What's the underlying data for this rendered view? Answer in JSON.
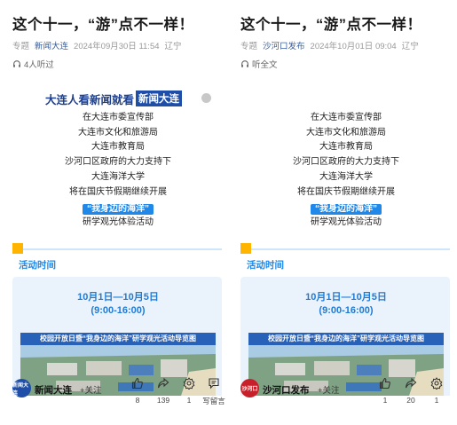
{
  "articles": [
    {
      "title": "这个十一，“游”点不一样！",
      "meta": {
        "tag": "专题",
        "source": "新闻大连",
        "datetime": "2024年09月30日 11:54",
        "region": "辽宁"
      },
      "listen_text": "4人听过",
      "banner": {
        "text": "大连人看新闻就看",
        "highlight": "新闻大连"
      },
      "lines": [
        "在大连市委宣传部",
        "大连市文化和旅游局",
        "大连市教育局",
        "沙河口区政府的大力支持下",
        "大连海洋大学",
        "将在国庆节假期继续开展",
        "“我身边的海洋”",
        "研学观光体验活动"
      ],
      "section_title": "活动时间",
      "dates": "10月1日—10月5日",
      "hours": "(9:00-16:00)",
      "map_title": "校园开放日暨“我身边的海洋”研学观光活动导览图",
      "account": {
        "name": "新闻大连",
        "logo_text": "新闻大连",
        "logo_color": "#1e4ea8",
        "follow": "+关注"
      },
      "actions": [
        {
          "icon": "thumbs-up-icon",
          "count": "8"
        },
        {
          "icon": "share-icon",
          "count": "139"
        },
        {
          "icon": "gear-icon",
          "count": "1"
        },
        {
          "icon": "comment-icon",
          "count": "写留言"
        }
      ]
    },
    {
      "title": "这个十一，“游”点不一样！",
      "meta": {
        "tag": "专题",
        "source": "沙河口发布",
        "datetime": "2024年10月01日 09:04",
        "region": "辽宁"
      },
      "listen_text": "听全文",
      "banner": {
        "text": "",
        "highlight": ""
      },
      "lines": [
        "在大连市委宣传部",
        "大连市文化和旅游局",
        "大连市教育局",
        "沙河口区政府的大力支持下",
        "大连海洋大学",
        "将在国庆节假期继续开展",
        "“我身边的海洋”",
        "研学观光体验活动"
      ],
      "section_title": "活动时间",
      "dates": "10月1日—10月5日",
      "hours": "(9:00-16:00)",
      "map_title": "校园开放日暨“我身边的海洋”研学观光活动导览图",
      "account": {
        "name": "沙河口发布",
        "logo_text": "沙河口",
        "logo_color": "#c8202a",
        "follow": "+关注"
      },
      "actions": [
        {
          "icon": "thumbs-up-icon",
          "count": "1"
        },
        {
          "icon": "share-icon",
          "count": "20"
        },
        {
          "icon": "gear-icon",
          "count": "1"
        }
      ]
    }
  ],
  "colors": {
    "accent_blue": "#1f88e8",
    "accent_yellow": "#ffb400",
    "source_link": "#3a5f9c"
  }
}
